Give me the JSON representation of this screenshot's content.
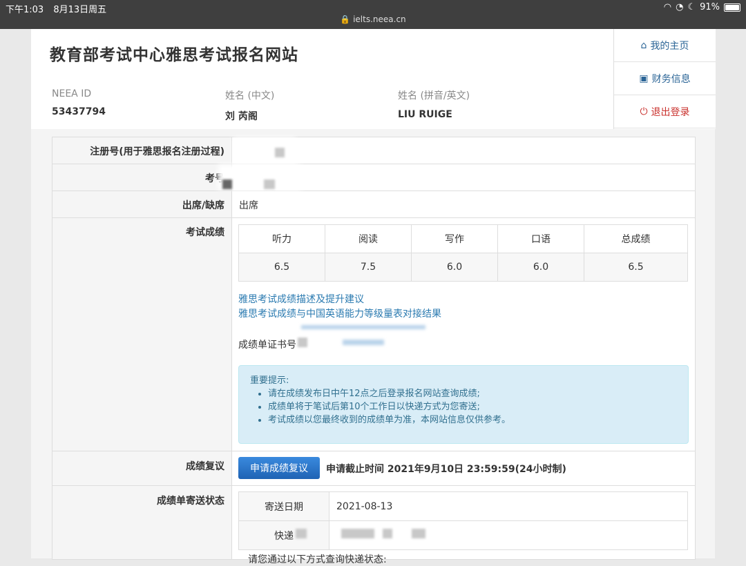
{
  "status_bar": {
    "time": "下午1:03",
    "date": "8月13日周五",
    "url": "ielts.neea.cn",
    "battery": "91%",
    "battery_level": 0.91
  },
  "header": {
    "title": "教育部考试中心雅思考试报名网站",
    "neea_id_label": "NEEA ID",
    "neea_id": "53437794",
    "name_cn_label": "姓名 (中文)",
    "name_cn": "刘 芮阁",
    "name_en_label": "姓名 (拼音/英文)",
    "name_en": "LIU  RUIGE"
  },
  "nav": {
    "home": "我的主页",
    "finance": "财务信息",
    "logout": "退出登录"
  },
  "rows": {
    "reg_no_label": "注册号(用于雅思报名注册过程)",
    "exam_no_label": "考号",
    "attendance_label": "出席/缺席",
    "attendance_value": "出席",
    "score_label": "考试成绩",
    "review_label": "成绩复议",
    "shipping_label": "成绩单寄送状态"
  },
  "scores": {
    "headers": [
      "听力",
      "阅读",
      "写作",
      "口语",
      "总成绩"
    ],
    "values": [
      "6.5",
      "7.5",
      "6.0",
      "6.0",
      "6.5"
    ]
  },
  "links": {
    "description": "雅思考试成绩描述及提升建议",
    "cse": "雅思考试成绩与中国英语能力等级量表对接结果"
  },
  "trf_label": "成绩单证书号",
  "notice": {
    "title": "重要提示:",
    "items": [
      "请在成绩发布日中午12点之后登录报名网站查询成绩;",
      "成绩单将于笔试后第10个工作日以快递方式为您寄送;",
      "考试成绩以您最终收到的成绩单为准，本网站信息仅供参考。"
    ]
  },
  "review": {
    "button": "申请成绩复议",
    "deadline": "申请截止时间 2021年9月10日 23:59:59(24小时制)"
  },
  "shipping": {
    "date_label": "寄送日期",
    "date_value": "2021-08-13",
    "courier_label": "快递",
    "query_text": "请您通过以下方式查询快递状态:"
  },
  "colors": {
    "link": "#2a7ab0",
    "button": "#2b74c8",
    "notice_bg": "#d9edf7",
    "logout": "#c9302c"
  }
}
